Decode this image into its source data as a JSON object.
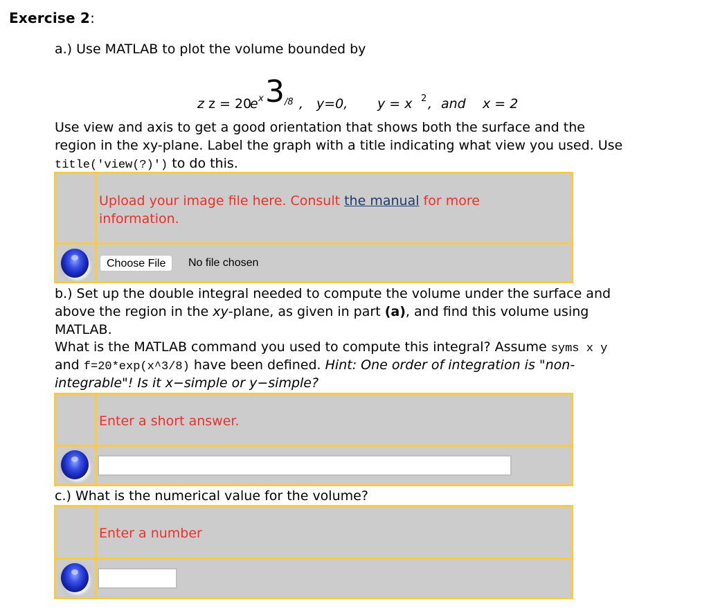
{
  "heading": {
    "title": "Exercise 2",
    "colon": ":"
  },
  "part_a": {
    "intro": "a.) Use MATLAB to plot the volume bounded by",
    "formula": {
      "z_eq": "z = 20 ",
      "e": "e",
      "x": "x",
      "three": "3",
      "over8": "/8",
      "comma1": ",",
      "y0": "y=0,",
      "y_eq": "y = x",
      "sq": "2",
      "comma2": ",",
      "and": "and",
      "x_eq": "x = 2"
    },
    "line1": "Use view and axis to get a good orientation that shows both the surface and the",
    "line2": "region in the xy-plane. Label the graph with a title indicating what view you used. Use",
    "code": "title('view(?)')",
    "line3_rest": " to do this.",
    "answer": {
      "prompt_before": "Upload your image file here. Consult ",
      "link": "the manual",
      "prompt_after": " for more",
      "prompt_line2": "information.",
      "choose_file_label": "Choose File",
      "file_status": "No file chosen"
    }
  },
  "part_b": {
    "line1": "b.) Set up the double integral needed to compute the volume under the surface and",
    "line2_a": "above the region in the ",
    "line2_xy": "xy",
    "line2_b": "-plane, as given in part ",
    "line2_bold": "(a)",
    "line2_c": ", and find this volume using",
    "line3": "MATLAB.",
    "line4_a": "What is the MATLAB command you used to compute this integral? Assume ",
    "line4_code": "syms x y",
    "line5_a": "and ",
    "line5_code": "f=20*exp(x^3/8)",
    "line5_b": " have been defined. ",
    "line5_hint": "Hint: One order of integration is \"non-",
    "line6_hint": "integrable\"! Is it x−simple or y−simple?",
    "answer": {
      "prompt": "Enter a short answer.",
      "value": ""
    }
  },
  "part_c": {
    "question": "c.) What is the numerical value for the volume?",
    "answer": {
      "prompt": "Enter a number",
      "value": ""
    }
  },
  "colors": {
    "prompt_red": "#e8312a",
    "table_border": "#f7cb45",
    "table_bg": "#cccccc",
    "link_blue": "#1f3a6b"
  }
}
